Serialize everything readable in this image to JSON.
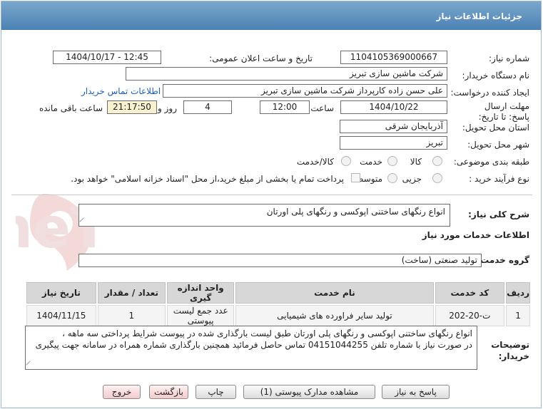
{
  "header": {
    "title": "جزئیات اطلاعات نیاز"
  },
  "form": {
    "need_number_label": "شماره نیاز:",
    "need_number": "1104105369000667",
    "announce_label": "تاریخ و ساعت اعلان عمومی:",
    "announce_value": "1404/10/17 - 12:45",
    "buyer_org_label": "نام دستگاه خریدار:",
    "buyer_org": "شرکت ماشین سازی تبریز",
    "creator_label": "ایجاد کننده درخواست:",
    "creator": "علی حسن زاده کارپرداز شرکت ماشین سازی تبریز",
    "contact_link": "اطلاعات تماس خریدار",
    "deadline_label": "مهلت ارسال پاسخ: تا تاریخ:",
    "deadline_date": "1404/10/22",
    "time_label": "ساعت",
    "deadline_time": "12:00",
    "days_value": "4",
    "days_label": "روز و",
    "remaining_time": "21:17:50",
    "remaining_label": "ساعت باقی مانده",
    "province_label": "استان محل تحویل:",
    "province": "آذربایجان شرقی",
    "city_label": "شهر محل تحویل:",
    "city": "تبریز",
    "category_label": "طبقه بندی موضوعی:",
    "category_options": [
      "کالا",
      "خدمت",
      "کالا/خدمت"
    ],
    "process_label": "نوع فرآیند خرید :",
    "process_options": [
      "جزیی",
      "متوسط"
    ],
    "payment_note": "پرداخت تمام یا بخشی از مبلغ خرید،از محل \"اسناد خزانه اسلامی\" خواهد بود."
  },
  "summary": {
    "label": "شرح کلی نیاز:",
    "value": "انواع رنگهای ساختنی اپوکسی و رنگهای پلی اورتان"
  },
  "services": {
    "section_title": "اطلاعات خدمات مورد نیاز",
    "group_label": "گروه خدمت:",
    "group_value": "تولید صنعتی (ساخت)"
  },
  "table": {
    "columns": [
      "ردیف",
      "کد خدمت",
      "نام خدمت",
      "واحد اندازه گیری",
      "تعداد / مقدار",
      "تاریخ نیاز"
    ],
    "rows": [
      {
        "row": "1",
        "code": "ت-20-202",
        "name": "تولید سایر فراورده های شیمیایی",
        "unit": "عدد جمع لیست پیوستی",
        "qty": "1",
        "date": "1404/11/15"
      }
    ]
  },
  "notes": {
    "label": "توضیحات خریدار:",
    "line1": "انواع رنگهای ساختنی اپوکسی و رنگهای پلی اورتان طبق لیست بارگذاری شده در پیوست شرایط پرداختی سه ماهه ،",
    "line2": "در صورت نیاز با شماره تلفن 04151044255 تماس حاصل فرمائید همچنین بارگذاری شماره همراه در سامانه جهت پیگیری"
  },
  "buttons": {
    "reply": "پاسخ به نیاز",
    "attachments": "مشاهده مدارک پیوستی (1)",
    "print": "چاپ",
    "back": "بازگشت",
    "exit": "خروج"
  },
  "watermark": {
    "text": "AriaTender.neT"
  },
  "colors": {
    "header": "#5a8fbe",
    "link": "#1a5fb8",
    "highlight": "#f7f1cf",
    "watermark": "#f4d9d9"
  }
}
